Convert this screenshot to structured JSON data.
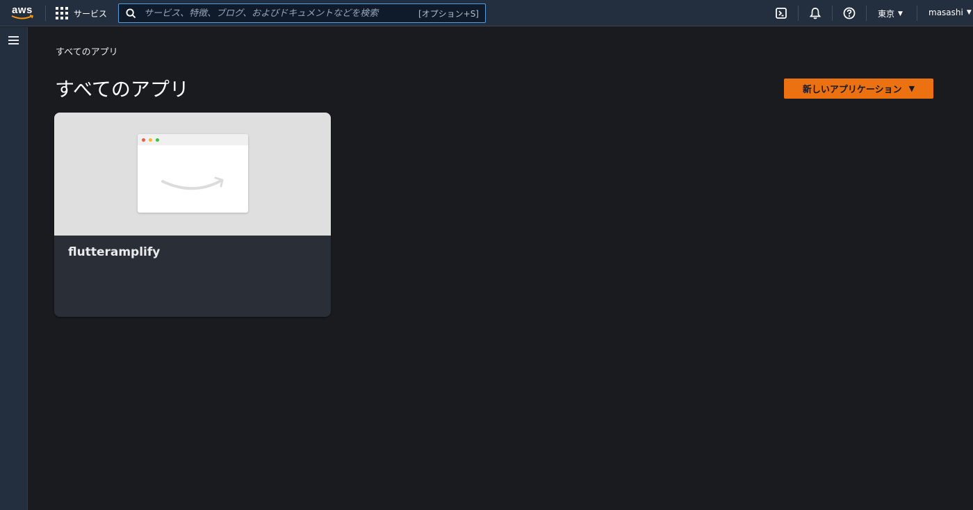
{
  "topbar": {
    "logo_text": "aws",
    "services_label": "サービス",
    "search_placeholder": "サービス、特徴、ブログ、およびドキュメントなどを検索",
    "search_shortcut": "[オプション+S]",
    "region": "東京",
    "user": "masashi",
    "icons": [
      "cloudshell-icon",
      "notifications-icon",
      "help-icon"
    ]
  },
  "breadcrumb": "すべてのアプリ",
  "page_title": "すべてのアプリ",
  "new_app_button": "新しいアプリケーション",
  "apps": [
    {
      "name": "flutteramplify"
    }
  ],
  "colors": {
    "topbar": "#232f3e",
    "background": "#1a1b1f",
    "accent": "#ec7211",
    "card_body": "#2a2e36",
    "card_preview": "#dfdfdf"
  }
}
